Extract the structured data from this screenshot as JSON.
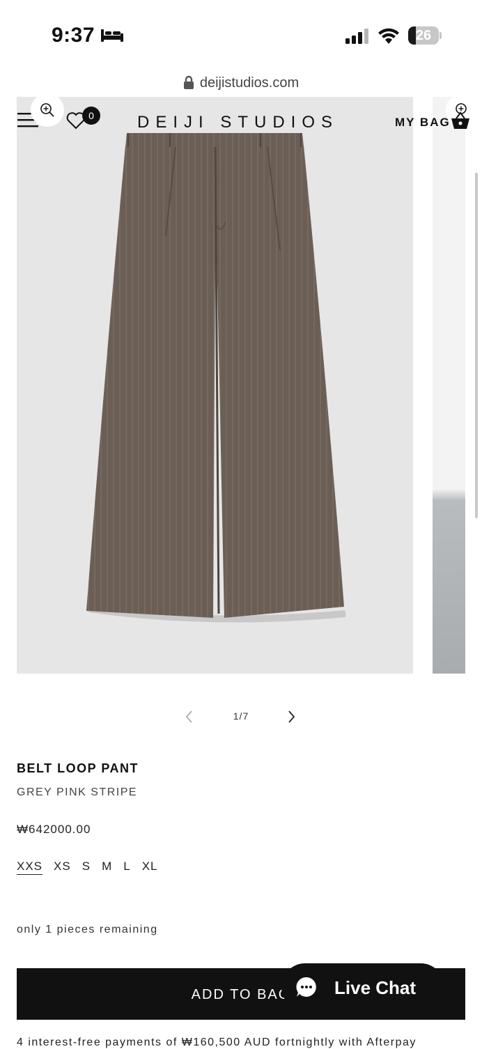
{
  "status_bar": {
    "time": "9:37",
    "battery_level": "26",
    "battery_fraction": 0.26,
    "icons": [
      "bed-icon",
      "cellular-signal-icon",
      "wifi-icon",
      "battery-icon"
    ]
  },
  "browser": {
    "url": "deijistudios.com",
    "icons": [
      "lock-icon"
    ]
  },
  "header": {
    "brand": "DEIJI STUDIOS",
    "wishlist_count": "0",
    "bag_label": "MY BAG",
    "icons": [
      "menu-icon",
      "zoom-in-icon",
      "heart-icon",
      "basket-icon"
    ]
  },
  "gallery": {
    "pager": "1/7",
    "image_description_icon": "trousers-image",
    "icons": [
      "chevron-left-icon",
      "chevron-right-icon"
    ]
  },
  "product": {
    "name": "BELT LOOP PANT",
    "color": "GREY PINK STRIPE",
    "price": "₩642000.00",
    "sizes": [
      "XXS",
      "XS",
      "S",
      "M",
      "L",
      "XL"
    ],
    "selected_size": "XXS",
    "stock_note": "only 1 pieces remaining"
  },
  "actions": {
    "add_to_bag": "ADD TO BAG",
    "live_chat": "Live Chat"
  },
  "afterpay_note": "4 interest-free payments of ₩160,500 AUD fortnightly with Afterpay",
  "colors": {
    "accent": "#111111",
    "image_background": "#e6e6e6",
    "fabric": "#6b5f55"
  }
}
